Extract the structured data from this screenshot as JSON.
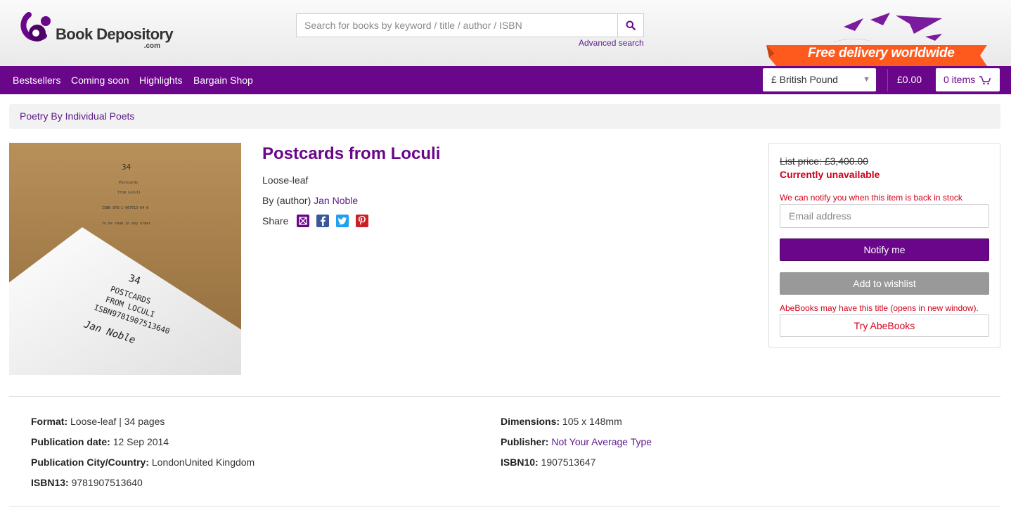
{
  "header": {
    "logo_name": "Book Depository",
    "logo_sub": ".com",
    "search_placeholder": "Search for books by keyword / title / author / ISBN",
    "advanced_search": "Advanced search",
    "promo_text": "Free delivery worldwide"
  },
  "nav": {
    "items": [
      "Bestsellers",
      "Coming soon",
      "Highlights",
      "Bargain Shop"
    ],
    "currency": "£ British Pound",
    "total": "£0.00",
    "basket": "0 items"
  },
  "breadcrumb": "Poetry By Individual Poets",
  "book": {
    "title": "Postcards from Loculi",
    "format": "Loose-leaf",
    "by_prefix": "By (author)",
    "author": "Jan Noble",
    "share_label": "Share",
    "cover_texts": [
      "34",
      "Postcards",
      "from Loculi",
      "ISBN 978-1-907513-64-0",
      "to be read in any order",
      "34",
      "POSTCARDS",
      "FROM LOCULI",
      "ISBN9781907513640",
      "Jan Noble"
    ]
  },
  "panel": {
    "list_price": "List price: £3,400.00",
    "status": "Currently unavailable",
    "notify_msg": "We can notify you when this item is back in stock",
    "email_placeholder": "Email address",
    "notify_btn": "Notify me",
    "wishlist_btn": "Add to wishlist",
    "abe_msg": "AbeBooks may have this title (opens in new window).",
    "abe_btn": "Try AbeBooks"
  },
  "details": {
    "format_label": "Format:",
    "format_value": "Loose-leaf | 34 pages",
    "pubdate_label": "Publication date:",
    "pubdate_value": "12 Sep 2014",
    "city_label": "Publication City/Country:",
    "city_value": "LondonUnited Kingdom",
    "isbn13_label": "ISBN13:",
    "isbn13_value": "9781907513640",
    "dims_label": "Dimensions:",
    "dims_value": "105 x 148mm",
    "publisher_label": "Publisher:",
    "publisher_value": "Not Your Average Type",
    "isbn10_label": "ISBN10:",
    "isbn10_value": "1907513647"
  },
  "colors": {
    "brand_purple": "#6a068a",
    "link_purple": "#5b1a8d",
    "alert_red": "#d0021b",
    "promo_orange": "#ff5a1e"
  },
  "icons": {
    "search": "search-icon",
    "basket": "basket-icon",
    "share": [
      "email-icon",
      "facebook-icon",
      "twitter-icon",
      "pinterest-icon"
    ]
  }
}
